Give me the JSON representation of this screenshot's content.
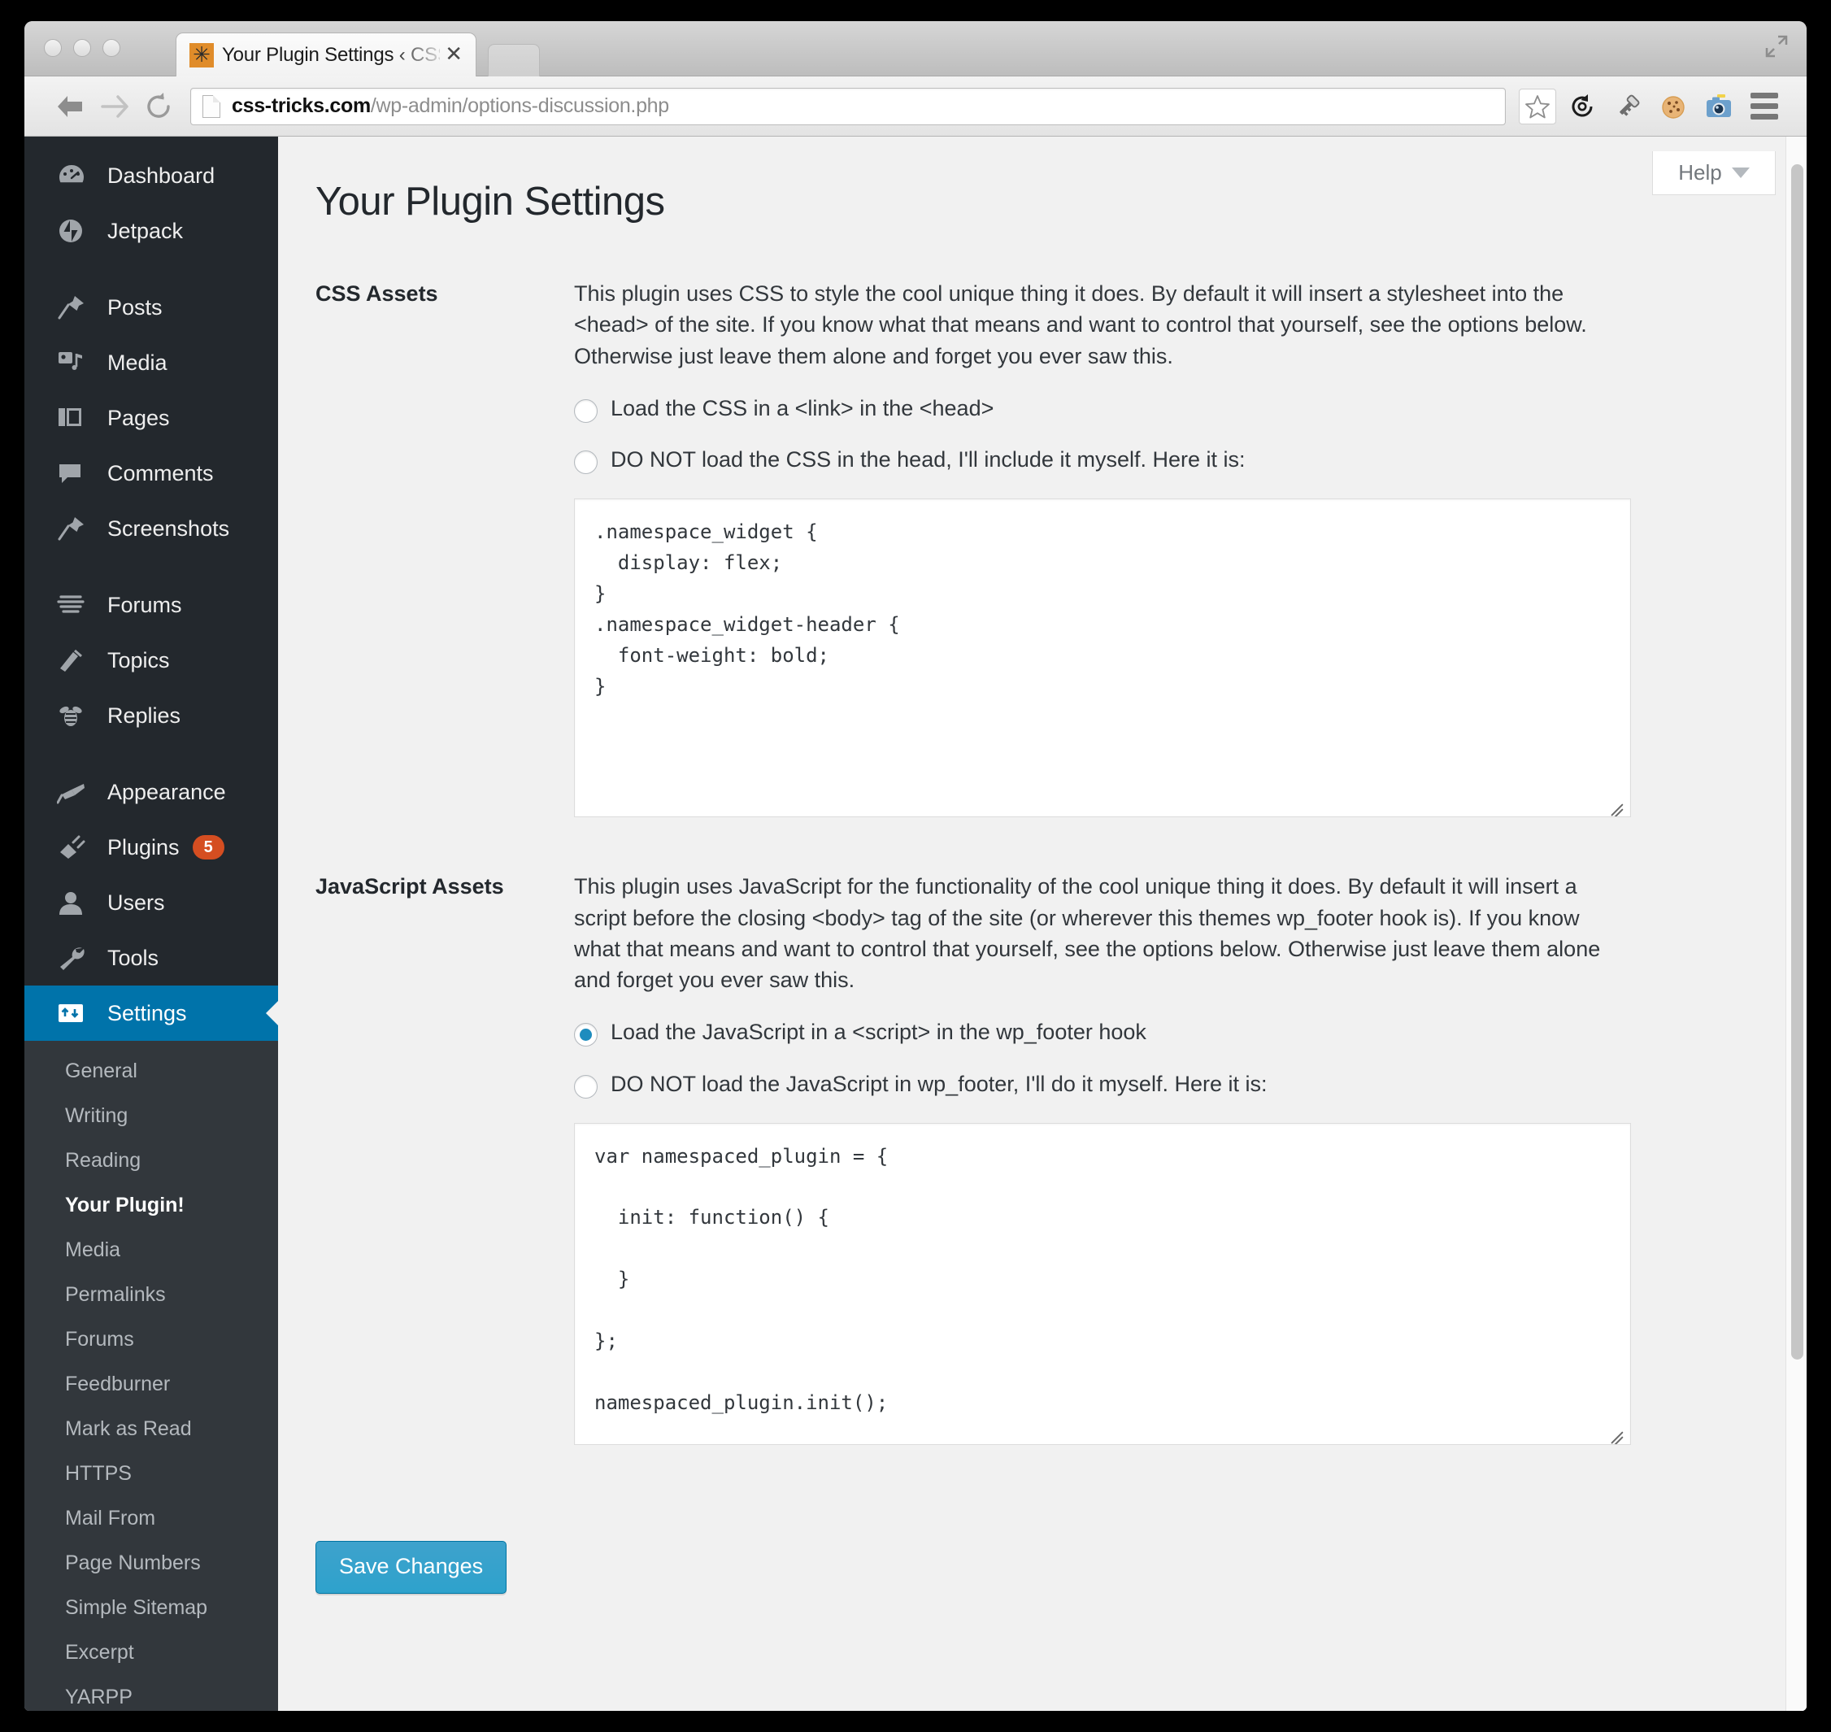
{
  "browser": {
    "tab": {
      "title": "Your Plugin Settings ‹ CSS-",
      "favicon_glyph": "✳",
      "close_label": "✕"
    },
    "url": {
      "domain": "css-tricks.com",
      "path": "/wp-admin/options-discussion.php"
    },
    "toolbar_icons": [
      {
        "name": "back-icon",
        "glyph": "←"
      },
      {
        "name": "forward-icon",
        "glyph": "→"
      },
      {
        "name": "reload-icon",
        "glyph": "⟳"
      },
      {
        "name": "bookmark-star-icon",
        "glyph": "☆"
      },
      {
        "name": "history-sync-icon",
        "glyph": "◌"
      },
      {
        "name": "key-icon",
        "glyph": "🔑"
      },
      {
        "name": "cookie-icon",
        "glyph": "🍪"
      },
      {
        "name": "camera-icon",
        "glyph": "📷"
      },
      {
        "name": "menu-hamburger-icon",
        "glyph": "☰"
      }
    ]
  },
  "sidebar": {
    "items": [
      {
        "label": "Dashboard",
        "icon": "dashboard-icon"
      },
      {
        "label": "Jetpack",
        "icon": "jetpack-icon"
      },
      {
        "label": "Posts",
        "icon": "pin-icon"
      },
      {
        "label": "Media",
        "icon": "media-icon"
      },
      {
        "label": "Pages",
        "icon": "pages-icon"
      },
      {
        "label": "Comments",
        "icon": "comment-icon"
      },
      {
        "label": "Screenshots",
        "icon": "pin-icon"
      },
      {
        "label": "Forums",
        "icon": "forums-icon"
      },
      {
        "label": "Topics",
        "icon": "topics-icon"
      },
      {
        "label": "Replies",
        "icon": "replies-bee-icon"
      },
      {
        "label": "Appearance",
        "icon": "brush-icon"
      },
      {
        "label": "Plugins",
        "icon": "plug-icon",
        "badge": "5"
      },
      {
        "label": "Users",
        "icon": "user-icon"
      },
      {
        "label": "Tools",
        "icon": "wrench-icon"
      },
      {
        "label": "Settings",
        "icon": "settings-icon",
        "active": true
      }
    ],
    "submenu": [
      {
        "label": "General"
      },
      {
        "label": "Writing"
      },
      {
        "label": "Reading"
      },
      {
        "label": "Your Plugin!",
        "current": true
      },
      {
        "label": "Media"
      },
      {
        "label": "Permalinks"
      },
      {
        "label": "Forums"
      },
      {
        "label": "Feedburner"
      },
      {
        "label": "Mark as Read"
      },
      {
        "label": "HTTPS"
      },
      {
        "label": "Mail From"
      },
      {
        "label": "Page Numbers"
      },
      {
        "label": "Simple Sitemap"
      },
      {
        "label": "Excerpt"
      },
      {
        "label": "YARPP"
      }
    ]
  },
  "content": {
    "help_label": "Help",
    "page_title": "Your Plugin Settings",
    "sections": [
      {
        "label": "CSS Assets",
        "description": "This plugin uses CSS to style the cool unique thing it does. By default it will insert a stylesheet into the <head> of the site. If you know what that means and want to control that yourself, see the options below. Otherwise just leave them alone and forget you ever saw this.",
        "radios": [
          {
            "label": "Load the CSS in a <link> in the <head>",
            "checked": false
          },
          {
            "label": "DO NOT load the CSS in the head, I'll include it myself. Here it is:",
            "checked": false
          }
        ],
        "code": ".namespace_widget {\n  display: flex;\n}\n.namespace_widget-header {\n  font-weight: bold;\n}"
      },
      {
        "label": "JavaScript Assets",
        "description": "This plugin uses JavaScript for the functionality of the cool unique thing it does. By default it will insert a script before the closing <body> tag of the site (or wherever this themes wp_footer hook is). If you know what that means and want to control that yourself, see the options below. Otherwise just leave them alone and forget you ever saw this.",
        "radios": [
          {
            "label": "Load the JavaScript in a <script> in the wp_footer hook",
            "checked": true
          },
          {
            "label": "DO NOT load the JavaScript in wp_footer, I'll do it myself. Here it is:",
            "checked": false
          }
        ],
        "code": "var namespaced_plugin = {\n\n  init: function() {\n\n  }\n\n};\n\nnamespaced_plugin.init();"
      }
    ],
    "save_label": "Save Changes"
  },
  "colors": {
    "wp_blue": "#0073aa",
    "button_blue": "#2ea2cc",
    "badge_orange": "#d54e21",
    "sidebar_dark": "#23282d",
    "submenu_dark": "#32373c"
  }
}
